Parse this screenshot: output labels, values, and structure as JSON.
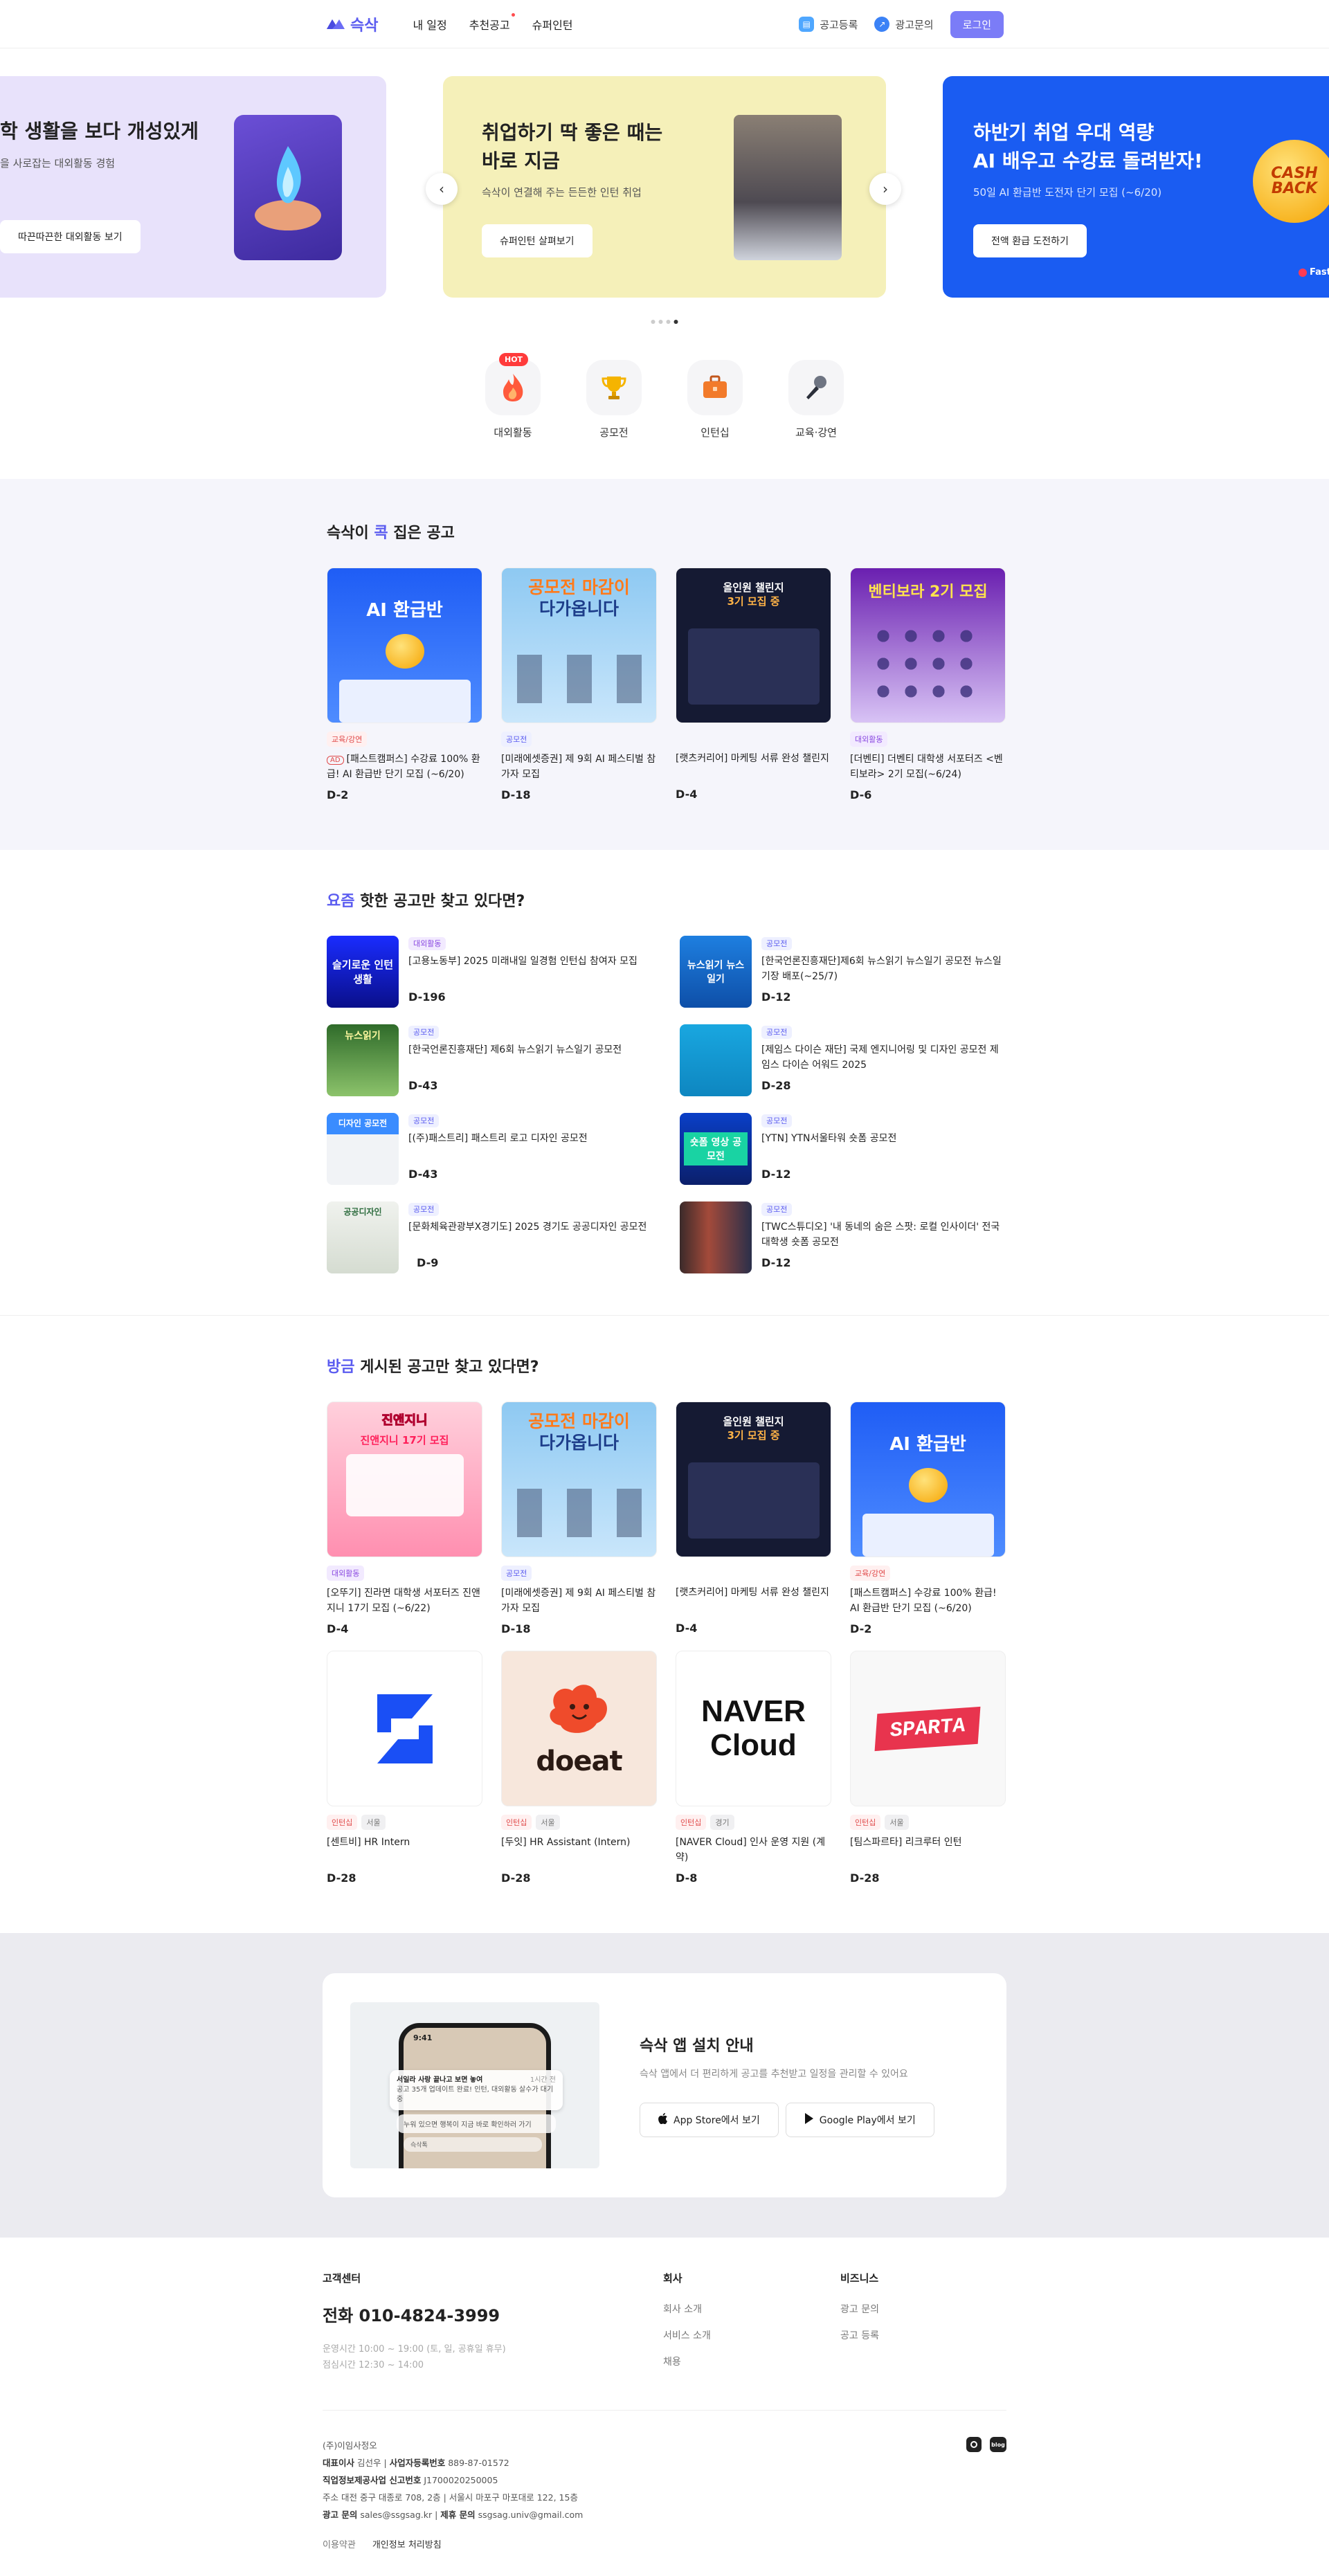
{
  "header": {
    "logo_text": "슥삭",
    "nav": [
      "내 일정",
      "추천공고",
      "슈퍼인턴"
    ],
    "ad_register": "공고등록",
    "ad_inquiry": "광고문의",
    "login": "로그인"
  },
  "banners": [
    {
      "title_line1": "학 생활을 보다 개성있게",
      "sub": "을 사로잡는 대외활동 경험",
      "button": "따끈따끈한 대외활동 보기"
    },
    {
      "title_line1": "취업하기 딱 좋은 때는",
      "title_line2": "바로 지금",
      "sub": "슥삭이 연결해 주는 든든한 인턴 취업",
      "button": "슈퍼인턴 살펴보기"
    },
    {
      "title_line1": "하반기 취업 우대 역량",
      "title_line2": "AI 배우고 수강료 돌려받자!",
      "sub": "50일 AI 환급반 도전자 단기 모집 (~6/20)",
      "button": "전액 환급 도전하기",
      "badge_line1": "CASH",
      "badge_line2": "BACK",
      "corner": "Fast"
    }
  ],
  "categories": [
    {
      "label": "대외활동",
      "icon": "fire-icon",
      "badge": "HOT"
    },
    {
      "label": "공모전",
      "icon": "trophy-icon"
    },
    {
      "label": "인턴십",
      "icon": "briefcase-icon"
    },
    {
      "label": "교육·강연",
      "icon": "microphone-icon"
    }
  ],
  "section1": {
    "title_pre": "슥삭이 ",
    "title_acc": "콕",
    "title_post": " 집은 공고",
    "cards": [
      {
        "tags": [
          "교육/강연"
        ],
        "badge": "AD",
        "title": "[패스트캠퍼스] 수강료 100% 환급! AI 환급반 단기 모집 (~6/20)",
        "dday": "D-2",
        "thumb_text": "AI 환급반"
      },
      {
        "tags": [
          "공모전"
        ],
        "title": "[미래에셋증권] 제 9회 AI 페스티벌 참가자 모집",
        "dday": "D-18",
        "thumb_text1": "공모전 마감이",
        "thumb_text2": "다가옵니다"
      },
      {
        "tags": [
          ""
        ],
        "title": "[랫츠커리어] 마케팅 서류 완성 챌린지",
        "dday": "D-4",
        "thumb_text1": "올인원 챌린지",
        "thumb_text2": "3기 모집 중"
      },
      {
        "tags": [
          "대외활동"
        ],
        "title": "[더벤티] 더벤티 대학생 서포터즈 <벤티보라> 2기 모집(~6/24)",
        "dday": "D-6",
        "thumb_text": "벤티보라 2기 모집"
      }
    ]
  },
  "section2": {
    "title_acc": "요즘",
    "title_post": " 핫한 공고만 찾고 있다면?",
    "items": [
      {
        "tag": "대외활동",
        "title": "[고용노동부] 2025 미래내일 일경험 인턴십 참여자 모집",
        "dday": "D-196",
        "thumb_text": "슬기로운 인턴생활"
      },
      {
        "tag": "공모전",
        "title": "[한국언론진흥재단]제6회 뉴스읽기 뉴스일기 공모전 뉴스일기장 배포(~25/7)",
        "dday": "D-12",
        "thumb_text": "뉴스읽기 뉴스일기"
      },
      {
        "tag": "공모전",
        "title": "[한국언론진흥재단] 제6회 뉴스읽기 뉴스일기 공모전",
        "dday": "D-43",
        "thumb_text": "뉴스읽기"
      },
      {
        "tag": "공모전",
        "title": "[제임스 다이슨 재단] 국제 엔지니어링 및 디자인 공모전 제임스 다이슨 어워드 2025",
        "dday": "D-28",
        "thumb_text": ""
      },
      {
        "tag": "공모전",
        "title": "[(주)패스트리] 패스트리 로고 디자인 공모전",
        "dday": "D-43",
        "thumb_text": "디자인 공모전"
      },
      {
        "tag": "공모전",
        "title": "[YTN] YTN서울타워 숏폼 공모전",
        "dday": "D-12",
        "thumb_text": "숏폼 영상 공모전"
      },
      {
        "tag": "공모전",
        "title": "[문화체육관광부X경기도] 2025 경기도 공공디자인 공모전",
        "dday": "D-9",
        "thumb_text": "공공디자인"
      },
      {
        "tag": "공모전",
        "title": "[TWC스튜디오] '내 동네의 숨은 스팟: 로컬 인사이더' 전국 대학생 숏폼 공모전",
        "dday": "D-12",
        "thumb_text": ""
      }
    ]
  },
  "section3": {
    "title_acc": "방금",
    "title_post": " 게시된 공고만 찾고 있다면?",
    "cards": [
      {
        "tags": [
          "대외활동"
        ],
        "title": "[오뚜기] 진라면 대학생 서포터즈 진앤지니 17기 모집 (~6/22)",
        "dday": "D-4",
        "thumb_text1": "진앤지니",
        "thumb_text2": "진앤지니 17기 모집"
      },
      {
        "tags": [
          "공모전"
        ],
        "title": "[미래에셋증권] 제 9회 AI 페스티벌 참가자 모집",
        "dday": "D-18",
        "thumb_text1": "공모전 마감이",
        "thumb_text2": "다가옵니다"
      },
      {
        "tags": [
          ""
        ],
        "title": "[랫츠커리어] 마케팅 서류 완성 챌린지",
        "dday": "D-4",
        "thumb_text1": "올인원 챌린지",
        "thumb_text2": "3기 모집 중"
      },
      {
        "tags": [
          "교육/강연"
        ],
        "title": "[패스트캠퍼스] 수강료 100% 환급! AI 환급반 단기 모집 (~6/20)",
        "dday": "D-2",
        "thumb_text": "AI 환급반"
      },
      {
        "tags": [
          "인턴십",
          "서울"
        ],
        "title": "[센트비] HR Intern",
        "dday": "D-28",
        "logo": "sentbe-logo"
      },
      {
        "tags": [
          "인턴십",
          "서울"
        ],
        "title": "[두잇] HR Assistant (Intern)",
        "dday": "D-28",
        "logo_text": "doeat"
      },
      {
        "tags": [
          "인턴십",
          "경기"
        ],
        "title": "[NAVER Cloud] 인사 운영 지원 (계약)",
        "dday": "D-8",
        "logo_text1": "NAVER",
        "logo_text2": "Cloud"
      },
      {
        "tags": [
          "인턴십",
          "서울"
        ],
        "title": "[팀스파르타] 리크루터 인턴",
        "dday": "D-28",
        "logo_text": "SPARTA"
      }
    ]
  },
  "app": {
    "title": "슥삭 앱 설치 안내",
    "sub": "슥삭 앱에서 더 편리하게 공고를 추천받고 일정을 관리할 수 있어요",
    "appstore": "App Store에서 보기",
    "googleplay": "Google Play에서 보기",
    "phone_time": "9:41",
    "notif1": "서일라 사랑 끝나고 보면 놓여",
    "notif1_sub": "공고 35개 업데이트 완료! 인턴, 대외활동 살수가 대기중",
    "notif1_time": "1시간 전",
    "notif2": "누워 있으면 행복이 지금 바로 확인하러 가기",
    "notif3": "슥삭톡"
  },
  "footer": {
    "cs_title": "고객센터",
    "phone": "전화 010-4824-3999",
    "hours1": "운영시간 10:00 ~ 19:00 (토, 일, 공휴일 휴무)",
    "hours2": "점심시간 12:30 ~ 14:00",
    "company_title": "회사",
    "company_links": [
      "회사 소개",
      "서비스 소개",
      "채용"
    ],
    "biz_title": "비즈니스",
    "biz_links": [
      "광고 문의",
      "공고 등록"
    ],
    "corp": "(주)이임사정오",
    "ceo_label": "대표이사",
    "ceo": "김선우",
    "bizno_label": "사업자등록번호",
    "bizno": "889-87-01572",
    "job_label": "직업정보제공사업 신고번호",
    "job_no": "J1700020250005",
    "addr": "주소 대전 중구 대종로 708, 2층 | 서울시 마포구 마포대로 122, 15층",
    "contact_label": "광고 문의",
    "contact": "sales@ssgsag.kr",
    "partner_label": "제휴 문의",
    "partner": "ssgsag.univ@gmail.com",
    "terms": "이용약관",
    "privacy": "개인정보 처리방침",
    "sns1": "instagram-icon",
    "sns2": "blog-icon",
    "blog_label": "blog"
  }
}
